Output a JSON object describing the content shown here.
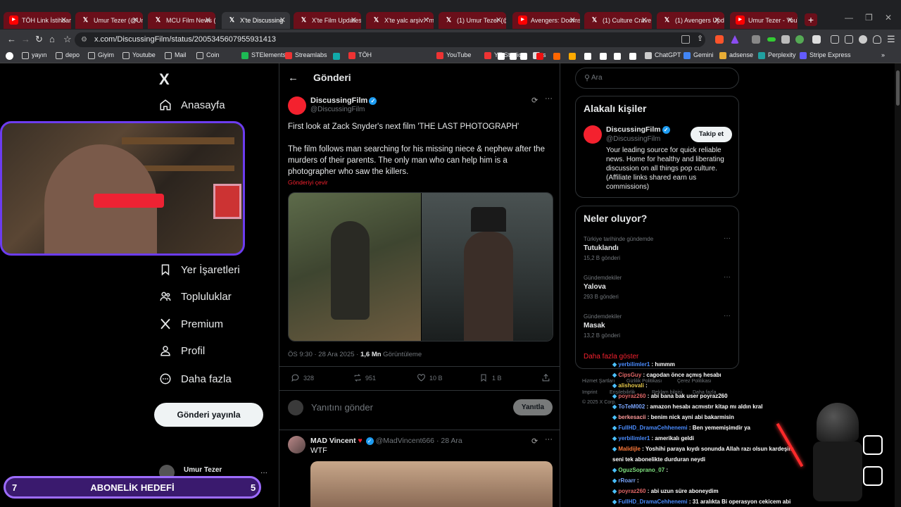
{
  "browser": {
    "tabs": [
      {
        "title": "TÖH Link İstihbarat",
        "icon": "youtube-icon",
        "icon_color": "#ff0000"
      },
      {
        "title": "Umur Tezer (@Umu",
        "icon": "x-icon",
        "icon_color": "#ffffff"
      },
      {
        "title": "MCU Film News (@",
        "icon": "x-icon",
        "icon_color": "#ffffff"
      },
      {
        "title": "X'te Discussing",
        "icon": "x-icon",
        "icon_color": "#ffffff"
      },
      {
        "title": "X'te Film Updates: \"",
        "icon": "x-icon",
        "icon_color": "#ffffff"
      },
      {
        "title": "X'te yalc arşiv: \"mo",
        "icon": "x-icon",
        "icon_color": "#ffffff"
      },
      {
        "title": "(1) Umur Tezer (@U",
        "icon": "x-icon",
        "icon_color": "#ffffff"
      },
      {
        "title": "Avengers: Doomsda",
        "icon": "youtube-icon",
        "icon_color": "#ff0000"
      },
      {
        "title": "(1) Culture Crave",
        "icon": "x-icon",
        "icon_color": "#ffffff"
      },
      {
        "title": "(1) Avengers Upda",
        "icon": "x-icon",
        "icon_color": "#ffffff"
      },
      {
        "title": "Umur Tezer - YouTu",
        "icon": "youtube-icon",
        "icon_color": "#ff0000"
      }
    ],
    "new_tab_label": "+",
    "url": "x.com/DiscussingFilm/status/2005345607955931413",
    "bookmarks": [
      "yayın",
      "depo",
      "Giyim",
      "Youtube",
      "Mail",
      "Coin",
      "STElements",
      "Streamlabs",
      "TÖH",
      "YouTube",
      "YT Studio",
      "s",
      "ChatGPT",
      "Gemini",
      "adsense",
      "Perplexity",
      "Stripe Express"
    ],
    "bookmarks_more": "»"
  },
  "sidebar": {
    "logo": "X",
    "items": [
      "Anasayfa",
      "Yer İşaretleri",
      "Topluluklar",
      "Premium",
      "Profil",
      "Daha fazla"
    ],
    "post_button": "Gönderi yayınla",
    "account_name": "Umur Tezer",
    "account_more": "···"
  },
  "main": {
    "header_title": "Gönderi",
    "back_icon": "arrow-left-icon",
    "tweet": {
      "author": "DiscussingFilm",
      "handle": "@DiscussingFilm",
      "text_line1": "First look at Zack Snyder's next film 'THE LAST PHOTOGRAPH'",
      "text_line2": "The film follows man searching for his missing niece & nephew after the murders of their parents. The only man who can help him is a photographer who saw the killers.",
      "translate": "Gönderiyi çevir",
      "time": "ÖS 9:30 · 28 Ara 2025 · ",
      "views_count": "1,6 Mn",
      "views_label": " Görüntüleme",
      "replies": "328",
      "reposts": "951",
      "likes": "10 B",
      "bookmarks": "1 B"
    },
    "reply_placeholder": "Yanıtını gönder",
    "reply_button": "Yanıtla",
    "reply_tweet": {
      "author": "MAD Vincent",
      "handle": "@MadVincent666",
      "date": "28 Ara",
      "text": "WTF"
    }
  },
  "right": {
    "search_placeholder": "Ara",
    "related_title": "Alakalı kişiler",
    "related_name": "DiscussingFilm",
    "related_handle": "@DiscussingFilm",
    "follow_button": "Takip et",
    "related_bio": "Your leading source for quick reliable news. Home for healthy and liberating discussion on all things pop culture. (Affiliate links shared earn us commissions)",
    "trends_title": "Neler oluyor?",
    "trends": [
      {
        "category": "Türkiye tarihinde gündemde",
        "title": "Tutuklandı",
        "count": "15,2 B gönderi"
      },
      {
        "category": "Gündemdekiler",
        "title": "Yalova",
        "count": "293 B gönderi"
      },
      {
        "category": "Gündemdekiler",
        "title": "Masak",
        "count": "13,2 B gönderi"
      }
    ],
    "show_more": "Daha fazla göster",
    "footer": [
      "Hizmet Şartları",
      "Gizlilik Politikası",
      "Çerez Politikası",
      "Imprint",
      "Erişilebilirlik",
      "Reklam bilgisi",
      "Daha fazla ...",
      "© 2025 X Corp."
    ]
  },
  "stream": {
    "goal_left": "7",
    "goal_label": "ABONELİK HEDEFİ",
    "goal_right": "5",
    "chat": [
      {
        "user": "yerbilimler1",
        "msg": "hımmm",
        "color": "#4a8cff"
      },
      {
        "user": "CipsGuy",
        "msg": "cagodan önce açmış hesabı",
        "color": "#e06666"
      },
      {
        "user": "alishovali",
        "msg": "",
        "color": "#e6c84a"
      },
      {
        "user": "poyraz260",
        "msg": "abi bana bak user poyraz260",
        "color": "#e06666"
      },
      {
        "user": "ToTeM002",
        "msg": "amazon hesabı acmıstır kitap mı aldın kral",
        "color": "#7aa6ff"
      },
      {
        "user": "berkesacii",
        "msg": "benim nick ayni abi bakarmisin",
        "color": "#ff9a9a"
      },
      {
        "user": "FullHD_DramaCehhenemi",
        "msg": "Ben yememişimdir ya",
        "color": "#4a8cff"
      },
      {
        "user": "yerbilimler1",
        "msg": "amerikalı geldi",
        "color": "#4a8cff"
      },
      {
        "user": "Malidijle",
        "msg": "Yoshihi paraya kıydı sonunda Allah razı olsun kardeşim",
        "color": "#ff7a3a"
      },
      {
        "user": "",
        "msg": "seni tek abonelikte durduran neydi",
        "color": "#ffffff"
      },
      {
        "user": "OguzSoprano_07",
        "msg": "",
        "color": "#7fe07f"
      },
      {
        "user": "rRoarr",
        "msg": "",
        "color": "#7aa6ff"
      },
      {
        "user": "poyraz260",
        "msg": "abi uzun süre aboneydim",
        "color": "#e06666"
      },
      {
        "user": "FullHD_DramaCehhenemi",
        "msg": "31 aralıkta Bi operasyon cekicem abi",
        "color": "#4a8cff"
      }
    ]
  },
  "colors": {
    "accent": "#1d9bf0",
    "brand_red": "#f4212e",
    "goal_purple": "#9d6cff"
  }
}
